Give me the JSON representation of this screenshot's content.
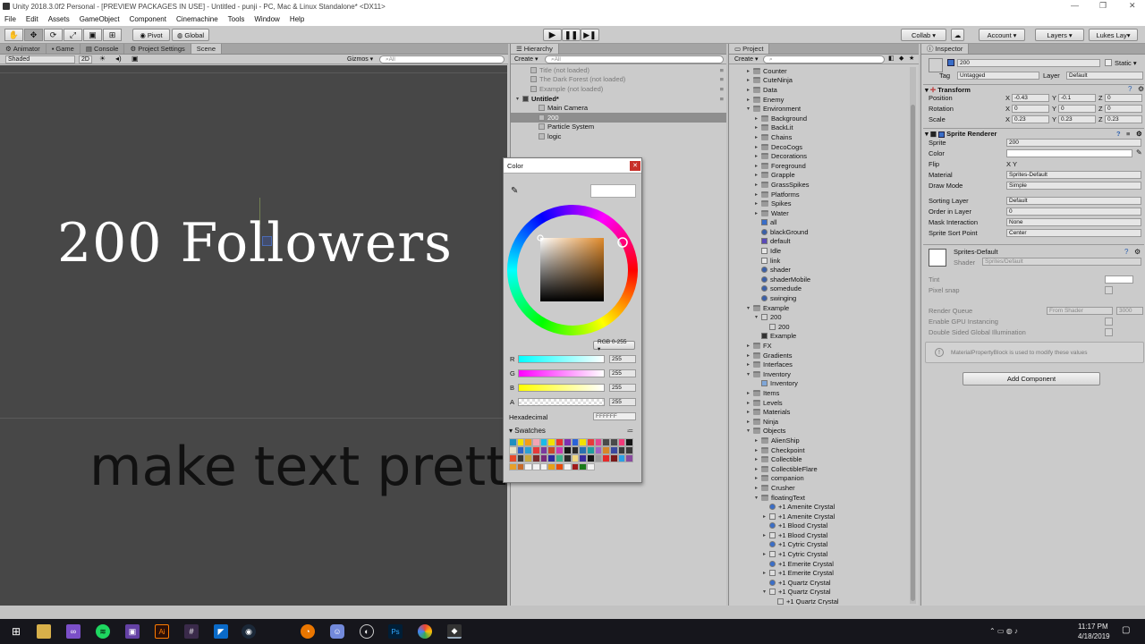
{
  "window": {
    "title": "Unity 2018.3.0f2 Personal - [PREVIEW PACKAGES IN USE] - Untitled - punji - PC, Mac & Linux Standalone* <DX11>",
    "min": "—",
    "max": "❐",
    "close": "✕"
  },
  "menu": [
    "File",
    "Edit",
    "Assets",
    "GameObject",
    "Component",
    "Cinemachine",
    "Tools",
    "Window",
    "Help"
  ],
  "toolbar": {
    "pivot": "Pivot",
    "global": "Global",
    "collab": "Collab ▾",
    "account": "Account",
    "layers": "Layers",
    "layout": "Lukes Lay▾"
  },
  "scene_panel": {
    "tabs": [
      "Animator",
      "Game",
      "Console",
      "Project Settings",
      "Scene"
    ],
    "shaded": "Shaded",
    "mode2d": "2D",
    "gizmos": "Gizmos ▾",
    "search_placeholder": "All",
    "text_main": "200 Followers",
    "text_sub": "make text pretty"
  },
  "hierarchy": {
    "tab": "Hierarchy",
    "create": "Create ▾",
    "search_placeholder": "All",
    "items": [
      {
        "label": "Title (not loaded)",
        "indent": 1,
        "dim": true
      },
      {
        "label": "The Dark Forest (not loaded)",
        "indent": 1,
        "dim": true
      },
      {
        "label": "Example (not loaded)",
        "indent": 1,
        "dim": true
      },
      {
        "label": "Untitled*",
        "indent": 0,
        "bold": true
      },
      {
        "label": "Main Camera",
        "indent": 2
      },
      {
        "label": "200",
        "indent": 2,
        "selected": true
      },
      {
        "label": "Particle System",
        "indent": 2
      },
      {
        "label": "logic",
        "indent": 2
      }
    ]
  },
  "color_picker": {
    "title": "Color",
    "mode": "RGB 0-255 ▾",
    "channels": [
      {
        "label": "R",
        "value": "255"
      },
      {
        "label": "G",
        "value": "255"
      },
      {
        "label": "B",
        "value": "255"
      },
      {
        "label": "A",
        "value": "255"
      }
    ],
    "hex_label": "Hexadecimal",
    "hex_value": "FFFFFF",
    "swatches_label": "Swatches",
    "swatch_colors": [
      "#1f8fc0",
      "#f2e200",
      "#f29d18",
      "#f2a5b4",
      "#1abbe8",
      "#f2e200",
      "#e6322f",
      "#7c2fb0",
      "#2a63d8",
      "#f2e200",
      "#e63b3b",
      "#e3468f",
      "#4a4a4a",
      "#4a4a4a",
      "#f23a7a",
      "#161616",
      "#e8e2c8",
      "#2f62c8",
      "#2aa1d3",
      "#e63a3a",
      "#7a3a9f",
      "#c84a2a",
      "#c83ab0",
      "#161616",
      "#2a2a2a",
      "#2a70b0",
      "#1f9f9f",
      "#9f62c8",
      "#d6882a",
      "#3a4aa0",
      "#3a3a3a",
      "#3a3a3a",
      "#e64a2a",
      "#3a3a3a",
      "#c8a83a",
      "#7a2a2a",
      "#7a2a7a",
      "#2a2a9f",
      "#3ab08a",
      "#2a2a2a",
      "#f2d880",
      "#3a2a9f",
      "#161616",
      "#9a9a9a",
      "#e62a2a",
      "#7a1a1a",
      "#2aa0e6",
      "#8a4a9f",
      "#e8a02a",
      "#c86a2a",
      "#f2f2f2",
      "#f2f2f2",
      "#f2f2f2",
      "#e6a01a",
      "#e64a0a",
      "#f2f2f2",
      "#a01a1a",
      "#1a7a1a",
      "#f2f2f2"
    ]
  },
  "project": {
    "tab": "Project",
    "create": "Create ▾",
    "search_placeholder": "",
    "items": [
      {
        "label": "Counter",
        "indent": 1,
        "type": "folder",
        "fold": "▸"
      },
      {
        "label": "CuteNinja",
        "indent": 1,
        "type": "folder",
        "fold": "▸"
      },
      {
        "label": "Data",
        "indent": 1,
        "type": "folder",
        "fold": "▸"
      },
      {
        "label": "Enemy",
        "indent": 1,
        "type": "folder",
        "fold": "▸"
      },
      {
        "label": "Environment",
        "indent": 1,
        "type": "folder",
        "fold": "▾"
      },
      {
        "label": "Background",
        "indent": 2,
        "type": "folder",
        "fold": "▸"
      },
      {
        "label": "BackLit",
        "indent": 2,
        "type": "folder",
        "fold": "▸"
      },
      {
        "label": "Chains",
        "indent": 2,
        "type": "folder",
        "fold": "▸"
      },
      {
        "label": "DecoCogs",
        "indent": 2,
        "type": "folder",
        "fold": "▸"
      },
      {
        "label": "Decorations",
        "indent": 2,
        "type": "folder",
        "fold": "▸"
      },
      {
        "label": "Foreground",
        "indent": 2,
        "type": "folder",
        "fold": "▸"
      },
      {
        "label": "Grapple",
        "indent": 2,
        "type": "folder",
        "fold": "▸"
      },
      {
        "label": "GrassSpikes",
        "indent": 2,
        "type": "folder",
        "fold": "▸"
      },
      {
        "label": "Platforms",
        "indent": 2,
        "type": "folder",
        "fold": "▸"
      },
      {
        "label": "Spikes",
        "indent": 2,
        "type": "folder",
        "fold": "▸"
      },
      {
        "label": "Water",
        "indent": 2,
        "type": "folder",
        "fold": "▸"
      },
      {
        "label": "all",
        "indent": 2,
        "type": "prefab"
      },
      {
        "label": "blackGround",
        "indent": 2,
        "type": "material"
      },
      {
        "label": "default",
        "indent": 2,
        "type": "anim"
      },
      {
        "label": "Idle",
        "indent": 2,
        "type": "doc"
      },
      {
        "label": "link",
        "indent": 2,
        "type": "doc"
      },
      {
        "label": "shader",
        "indent": 2,
        "type": "material"
      },
      {
        "label": "shaderMobile",
        "indent": 2,
        "type": "material"
      },
      {
        "label": "somedude",
        "indent": 2,
        "type": "material"
      },
      {
        "label": "swinging",
        "indent": 2,
        "type": "material"
      },
      {
        "label": "Example",
        "indent": 1,
        "type": "folder",
        "fold": "▾"
      },
      {
        "label": "200",
        "indent": 2,
        "type": "file",
        "fold": "▾"
      },
      {
        "label": "200",
        "indent": 3,
        "type": "file"
      },
      {
        "label": "Example",
        "indent": 2,
        "type": "unity"
      },
      {
        "label": "FX",
        "indent": 1,
        "type": "folder",
        "fold": "▸"
      },
      {
        "label": "Gradients",
        "indent": 1,
        "type": "folder",
        "fold": "▸"
      },
      {
        "label": "Interfaces",
        "indent": 1,
        "type": "folder",
        "fold": "▸"
      },
      {
        "label": "Inventory",
        "indent": 1,
        "type": "folder",
        "fold": "▾"
      },
      {
        "label": "Inventory",
        "indent": 2,
        "type": "script"
      },
      {
        "label": "Items",
        "indent": 1,
        "type": "folder",
        "fold": "▸"
      },
      {
        "label": "Levels",
        "indent": 1,
        "type": "folder",
        "fold": "▸"
      },
      {
        "label": "Materials",
        "indent": 1,
        "type": "folder",
        "fold": "▸"
      },
      {
        "label": "Ninja",
        "indent": 1,
        "type": "folder",
        "fold": "▸"
      },
      {
        "label": "Objects",
        "indent": 1,
        "type": "folder",
        "fold": "▾"
      },
      {
        "label": "AlienShip",
        "indent": 2,
        "type": "folder",
        "fold": "▸"
      },
      {
        "label": "Checkpoint",
        "indent": 2,
        "type": "folder",
        "fold": "▸"
      },
      {
        "label": "Collectible",
        "indent": 2,
        "type": "folder",
        "fold": "▸"
      },
      {
        "label": "CollectibleFlare",
        "indent": 2,
        "type": "folder",
        "fold": "▸"
      },
      {
        "label": "companion",
        "indent": 2,
        "type": "folder",
        "fold": "▸"
      },
      {
        "label": "Crusher",
        "indent": 2,
        "type": "folder",
        "fold": "▸"
      },
      {
        "label": "floatingText",
        "indent": 2,
        "type": "folder",
        "fold": "▾"
      },
      {
        "label": "+1 Amenite Crystal",
        "indent": 3,
        "type": "anim2"
      },
      {
        "label": "+1 Amenite Crystal",
        "indent": 3,
        "type": "prefab2",
        "fold": "▸"
      },
      {
        "label": "+1 Blood Crystal",
        "indent": 3,
        "type": "anim2"
      },
      {
        "label": "+1 Blood Crystal",
        "indent": 3,
        "type": "prefab2",
        "fold": "▸"
      },
      {
        "label": "+1 Cytric Crystal",
        "indent": 3,
        "type": "anim2"
      },
      {
        "label": "+1 Cytric Crystal",
        "indent": 3,
        "type": "prefab2",
        "fold": "▸"
      },
      {
        "label": "+1 Emerite Crystal",
        "indent": 3,
        "type": "anim2"
      },
      {
        "label": "+1 Emerite Crystal",
        "indent": 3,
        "type": "prefab2",
        "fold": "▸"
      },
      {
        "label": "+1 Quartz Crystal",
        "indent": 3,
        "type": "anim2"
      },
      {
        "label": "+1 Quartz Crystal",
        "indent": 3,
        "type": "prefab2",
        "fold": "▾"
      },
      {
        "label": "+1 Quartz Crystal",
        "indent": 4,
        "type": "file"
      }
    ]
  },
  "inspector": {
    "tab": "Inspector",
    "object_name": "200",
    "static": "Static ▾",
    "tag_label": "Tag",
    "tag_value": "Untagged",
    "layer_label": "Layer",
    "layer_value": "Default",
    "transform": {
      "title": "Transform",
      "rows": [
        {
          "label": "Position",
          "x": "-0.43",
          "y": "-0.1",
          "z": "0"
        },
        {
          "label": "Rotation",
          "x": "0",
          "y": "0",
          "z": "0"
        },
        {
          "label": "Scale",
          "x": "0.23",
          "y": "0.23",
          "z": "0.23"
        }
      ]
    },
    "sprite_renderer": {
      "title": "Sprite Renderer",
      "rows": [
        {
          "label": "Sprite",
          "value": "200"
        },
        {
          "label": "Color",
          "value": ""
        },
        {
          "label": "Flip",
          "value": "X   Y"
        },
        {
          "label": "Material",
          "value": "Sprites-Default"
        },
        {
          "label": "Draw Mode",
          "value": "Simple"
        },
        {
          "label": "Sorting Layer",
          "value": "Default"
        },
        {
          "label": "Order in Layer",
          "value": "0"
        },
        {
          "label": "Mask Interaction",
          "value": "None"
        },
        {
          "label": "Sprite Sort Point",
          "value": "Center"
        }
      ]
    },
    "material": {
      "name": "Sprites-Default",
      "shader_label": "Shader",
      "shader_value": "Sprites/Default",
      "rows": [
        {
          "label": "Tint"
        },
        {
          "label": "Pixel snap"
        },
        {
          "label": "Render Queue",
          "value": "From Shader",
          "value2": "3000"
        },
        {
          "label": "Enable GPU Instancing"
        },
        {
          "label": "Double Sided Global Illumination"
        }
      ],
      "info": "MaterialPropertyBlock is used to modify these values"
    },
    "add_component": "Add Component"
  },
  "taskbar": {
    "time": "11:17 PM",
    "date": "4/18/2019"
  }
}
